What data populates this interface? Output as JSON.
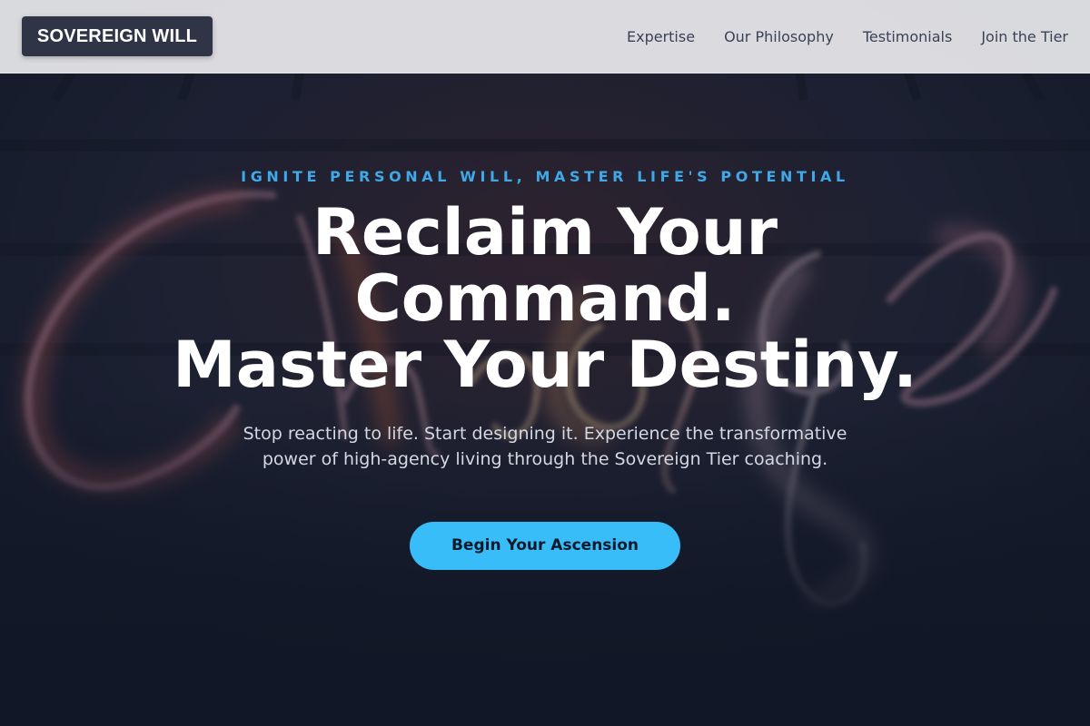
{
  "brand": {
    "logo_text": "SOVEREIGN WILL"
  },
  "nav": {
    "links": [
      {
        "label": "Expertise"
      },
      {
        "label": "Our Philosophy"
      },
      {
        "label": "Testimonials"
      },
      {
        "label": "Join the Tier"
      }
    ]
  },
  "hero": {
    "eyebrow": "IGNITE PERSONAL WILL, MASTER LIFE'S POTENTIAL",
    "headline_lines": [
      "Reclaim Your",
      "Command.",
      "Master Your Destiny."
    ],
    "subtext": "Stop reacting to life. Start designing it. Experience the transformative power of high-agency living through the Sovereign Tier coaching.",
    "cta_label": "Begin Your Ascension",
    "background_image": "neon-sign-change"
  },
  "colors": {
    "accent": "#38bdf8",
    "eyebrow": "#3fa9e8",
    "navbar_bg": "#e2e2e6",
    "logo_bg": "#2f3547",
    "page_bg": "#121a2b"
  }
}
